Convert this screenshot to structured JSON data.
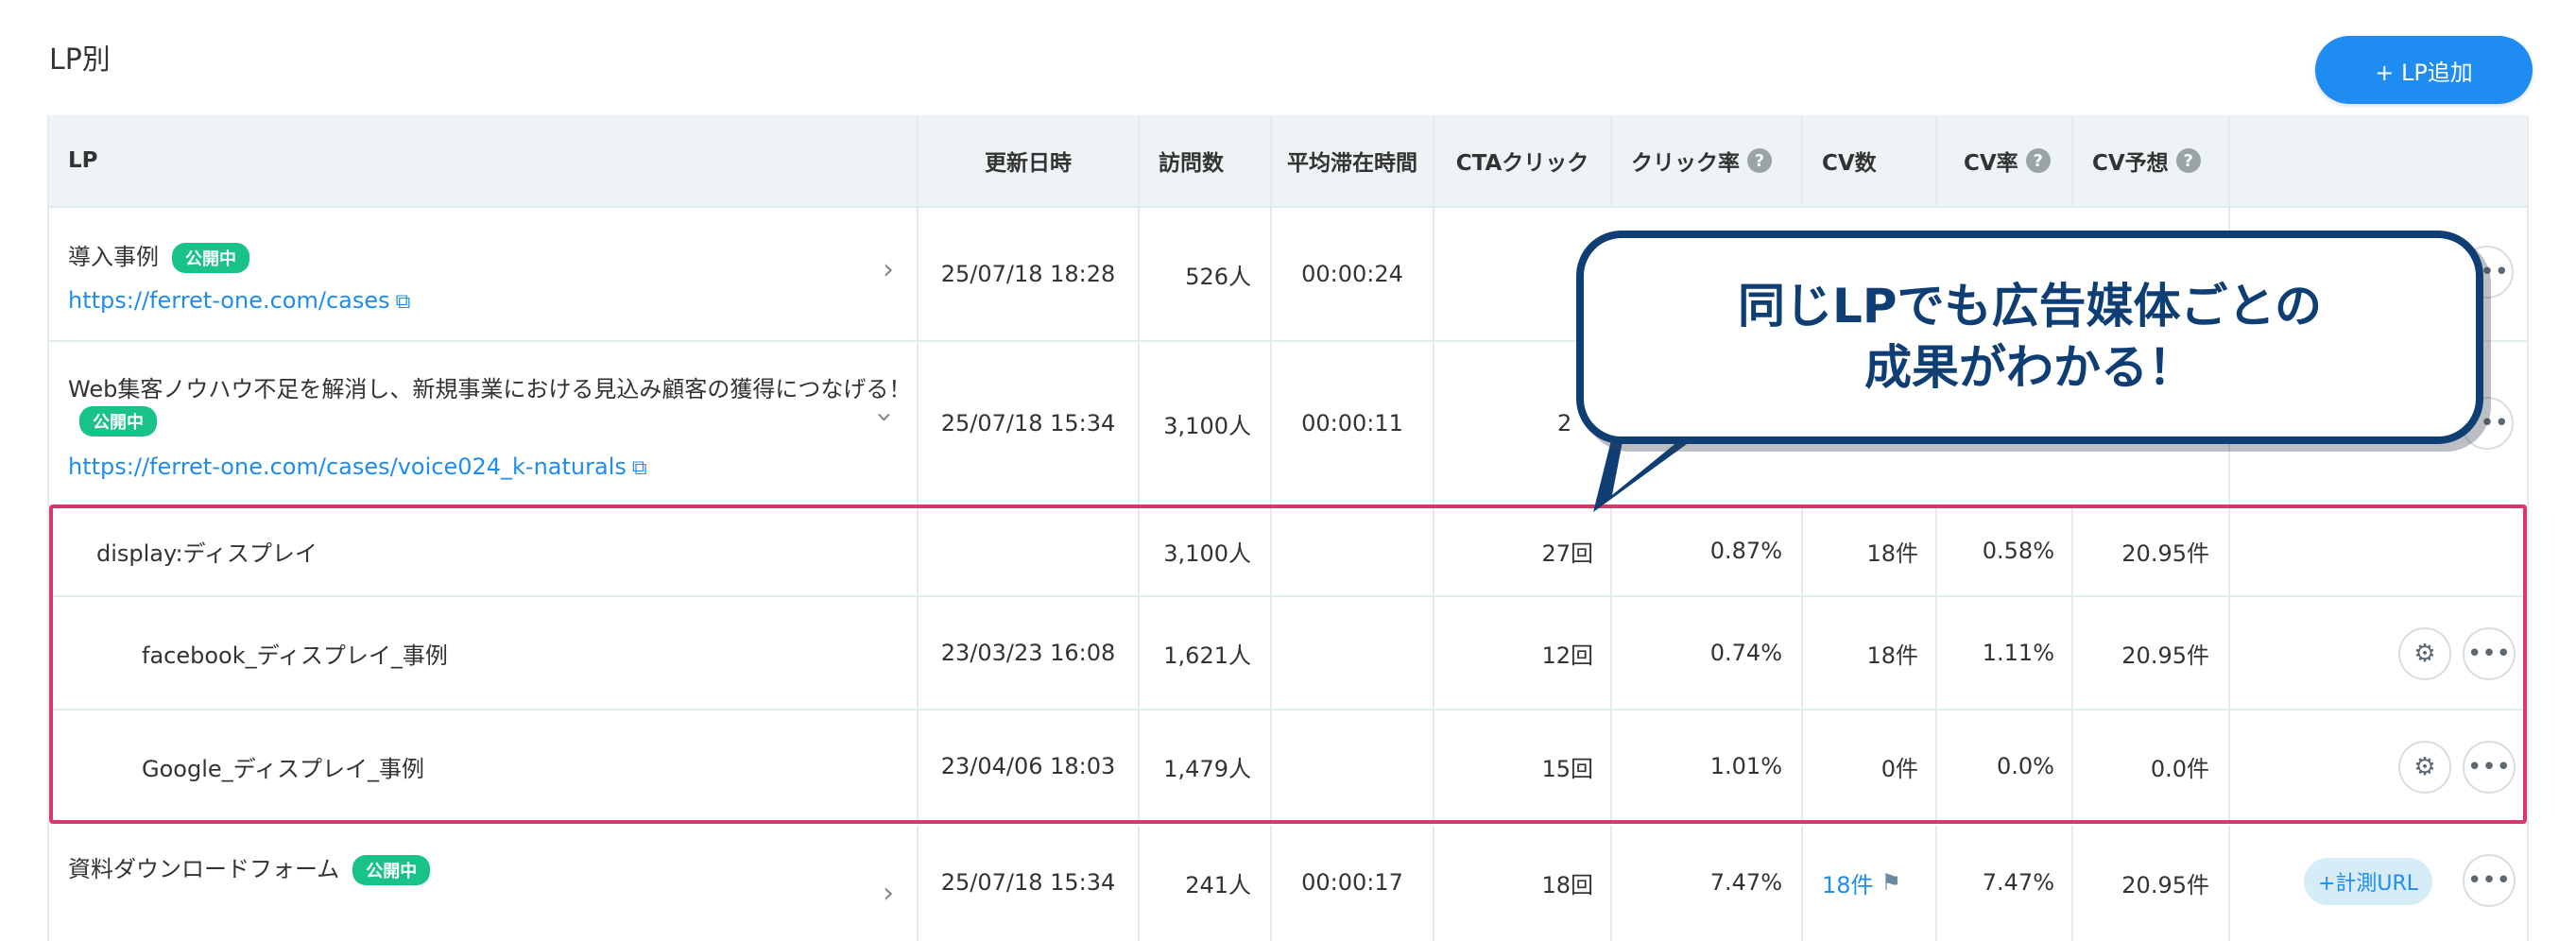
{
  "page": {
    "title": "LP別",
    "add_button": "+ LP追加"
  },
  "colors": {
    "accent": "#1e8cf0",
    "badge": "#19c28a",
    "highlight": "#d6396b",
    "callout": "#0f3e74"
  },
  "table": {
    "headers": {
      "lp": "LP",
      "updated": "更新日時",
      "visits": "訪問数",
      "avg_time": "平均滞在時間",
      "cta": "CTAクリック",
      "click_rate": "クリック率",
      "cv": "CV数",
      "cv_rate": "CV率",
      "cv_forecast": "CV予想"
    },
    "help_icon": "?",
    "rows": [
      {
        "name": "導入事例",
        "badge": "公開中",
        "url": "https://ferret-one.com/cases",
        "updated": "25/07/18 18:28",
        "visits": "526人",
        "avg_time": "00:00:24"
      },
      {
        "name": "Web集客ノウハウ不足を解消し、新規事業における見込み顧客の獲得につなげる！",
        "badge": "公開中",
        "url": "https://ferret-one.com/cases/voice024_k-naturals",
        "updated": "25/07/18 15:34",
        "visits": "3,100人",
        "avg_time": "00:00:11",
        "cta_partial": "2"
      },
      {
        "name": "display:ディスプレイ",
        "visits": "3,100人",
        "cta": "27回",
        "click_rate": "0.87%",
        "cv": "18件",
        "cv_rate": "0.58%",
        "cv_forecast": "20.95件"
      },
      {
        "name": "facebook_ディスプレイ_事例",
        "updated": "23/03/23 16:08",
        "visits": "1,621人",
        "cta": "12回",
        "click_rate": "0.74%",
        "cv": "18件",
        "cv_rate": "1.11%",
        "cv_forecast": "20.95件"
      },
      {
        "name": "Google_ディスプレイ_事例",
        "updated": "23/04/06 18:03",
        "visits": "1,479人",
        "cta": "15回",
        "click_rate": "1.01%",
        "cv": "0件",
        "cv_rate": "0.0%",
        "cv_forecast": "0.0件"
      },
      {
        "name": "資料ダウンロードフォーム",
        "badge": "公開中",
        "updated": "25/07/18 15:34",
        "visits": "241人",
        "avg_time": "00:00:17",
        "cta": "18回",
        "click_rate": "7.47%",
        "cv": "18件",
        "cv_rate": "7.47%",
        "cv_forecast": "20.95件",
        "url_button": "+計測URL"
      }
    ]
  },
  "callout": {
    "line1": "同じLPでも広告媒体ごとの",
    "line2": "成果がわかる！"
  },
  "icons": {
    "settings": "gear-icon",
    "more": "more-icon",
    "chevron": "chevron-icon",
    "external": "external-link-icon",
    "flag": "flag-icon"
  }
}
